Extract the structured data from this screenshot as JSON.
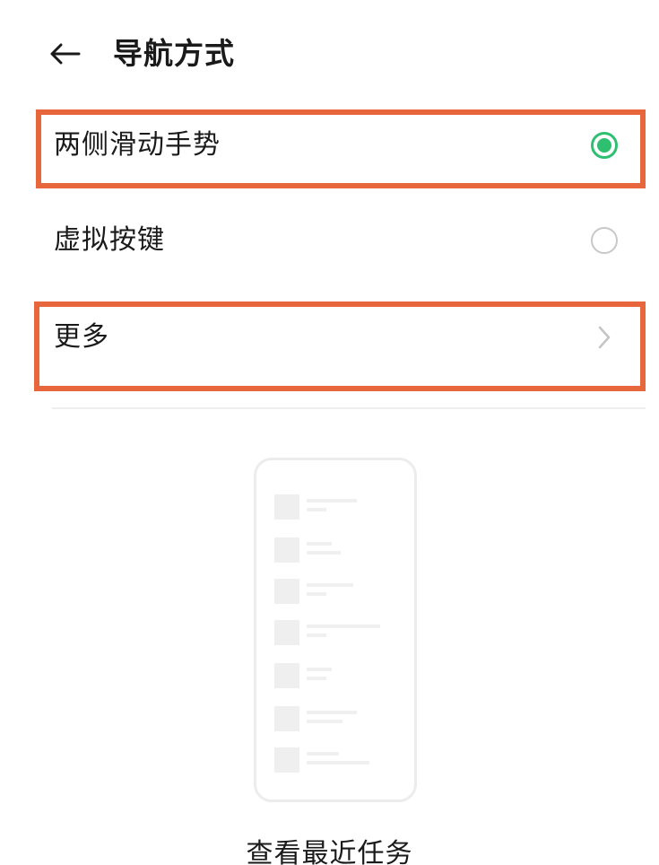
{
  "colors": {
    "accent": "#2fbf71",
    "highlight": "#e8663c",
    "background": "#ffffff"
  },
  "header": {
    "back_icon": "arrow-left-icon",
    "title": "导航方式"
  },
  "options": [
    {
      "label": "两侧滑动手势",
      "selected": true
    },
    {
      "label": "虚拟按键",
      "selected": false
    }
  ],
  "more": {
    "label": "更多",
    "icon": "chevron-right-icon"
  },
  "preview": {
    "caption": "查看最近任务"
  }
}
